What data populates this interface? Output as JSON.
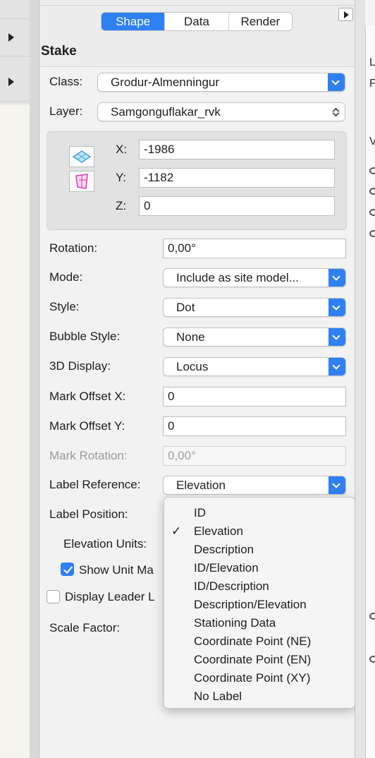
{
  "tabs": [
    "Shape",
    "Data",
    "Render"
  ],
  "object_title": "Stake",
  "class": {
    "label": "Class:",
    "value": "Grodur-Almenningur"
  },
  "layer": {
    "label": "Layer:",
    "value": "Samgonguflakar_rvk"
  },
  "coords": {
    "x_label": "X:",
    "x": "-1986",
    "y_label": "Y:",
    "y": "-1182",
    "z_label": "Z:",
    "z": "0"
  },
  "fields": {
    "rotation": {
      "label": "Rotation:",
      "value": "0,00°"
    },
    "mode": {
      "label": "Mode:",
      "value": "Include as site model..."
    },
    "style": {
      "label": "Style:",
      "value": "Dot"
    },
    "bubble_style": {
      "label": "Bubble Style:",
      "value": "None"
    },
    "display_3d": {
      "label": "3D Display:",
      "value": "Locus"
    },
    "mark_offset_x": {
      "label": "Mark Offset X:",
      "value": "0"
    },
    "mark_offset_y": {
      "label": "Mark Offset Y:",
      "value": "0"
    },
    "mark_rotation": {
      "label": "Mark Rotation:",
      "value": "0,00°"
    },
    "label_reference": {
      "label": "Label Reference:",
      "value": "Elevation"
    },
    "label_position": {
      "label": "Label Position:"
    },
    "elevation_units": {
      "label": "Elevation Units:"
    },
    "show_unit": {
      "label": "Show Unit Ma",
      "checked": true
    },
    "display_leader": {
      "label": "Display Leader L",
      "checked": false
    },
    "scale_factor": {
      "label": "Scale Factor:"
    }
  },
  "dropdown": {
    "selected": "Elevation",
    "options": [
      "ID",
      "Elevation",
      "Description",
      "ID/Elevation",
      "ID/Description",
      "Description/Elevation",
      "Stationing Data",
      "Coordinate Point (NE)",
      "Coordinate Point (EN)",
      "Coordinate Point (XY)",
      "No Label"
    ]
  },
  "right_panel": {
    "text1": "L",
    "text2": "F",
    "text3": "V"
  },
  "colors": {
    "accent": "#2f80f3"
  }
}
